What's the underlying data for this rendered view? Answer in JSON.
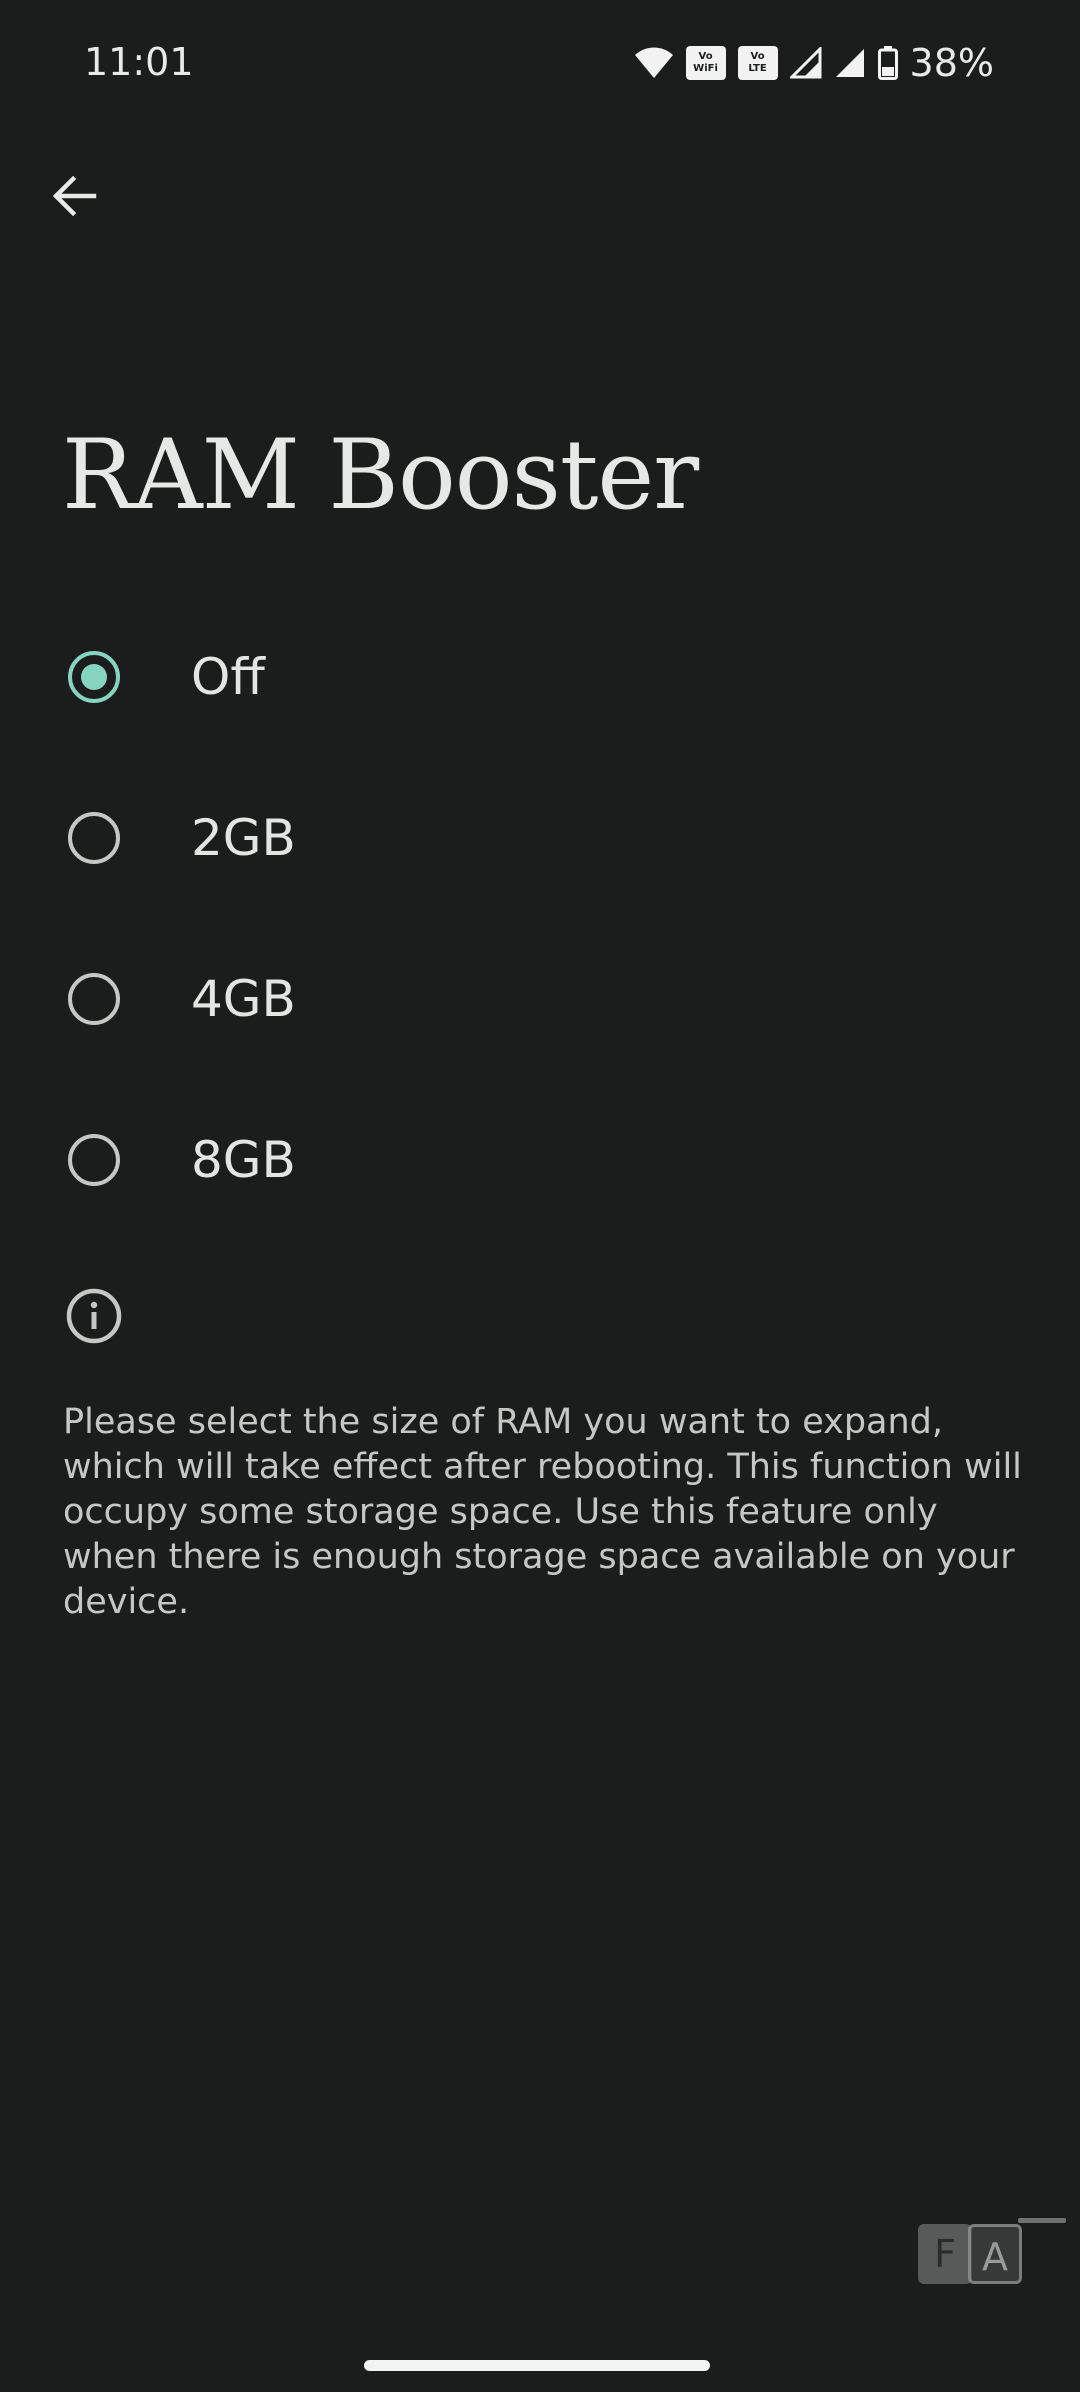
{
  "status_bar": {
    "time": "11:01",
    "battery_percent": "38%",
    "vowifi_badge": [
      "Vo",
      "WiFi"
    ],
    "volte_badge": [
      "Vo",
      "LTE"
    ],
    "icons": [
      "wifi-icon",
      "vowifi-icon",
      "volte-icon",
      "signal-icon",
      "signal-icon",
      "battery-icon"
    ]
  },
  "header": {
    "back_icon": "arrow-left-icon"
  },
  "page": {
    "title": "RAM Booster"
  },
  "options": {
    "selected": "Off",
    "items": [
      {
        "label": "Off",
        "selected": true
      },
      {
        "label": "2GB",
        "selected": false
      },
      {
        "label": "4GB",
        "selected": false
      },
      {
        "label": "8GB",
        "selected": false
      }
    ]
  },
  "info": {
    "icon": "info-icon",
    "text": "Please select the size of RAM you want to expand, which will take effect after rebooting. This function will occupy some storage space. Use this feature only when there is enough storage space available on your device."
  },
  "watermark": {
    "letters": [
      "F",
      "A"
    ]
  },
  "colors": {
    "background": "#1a1d1c",
    "accent": "#86d4c0",
    "text_primary": "#e3e5e3",
    "text_secondary": "#c4c8c5"
  }
}
